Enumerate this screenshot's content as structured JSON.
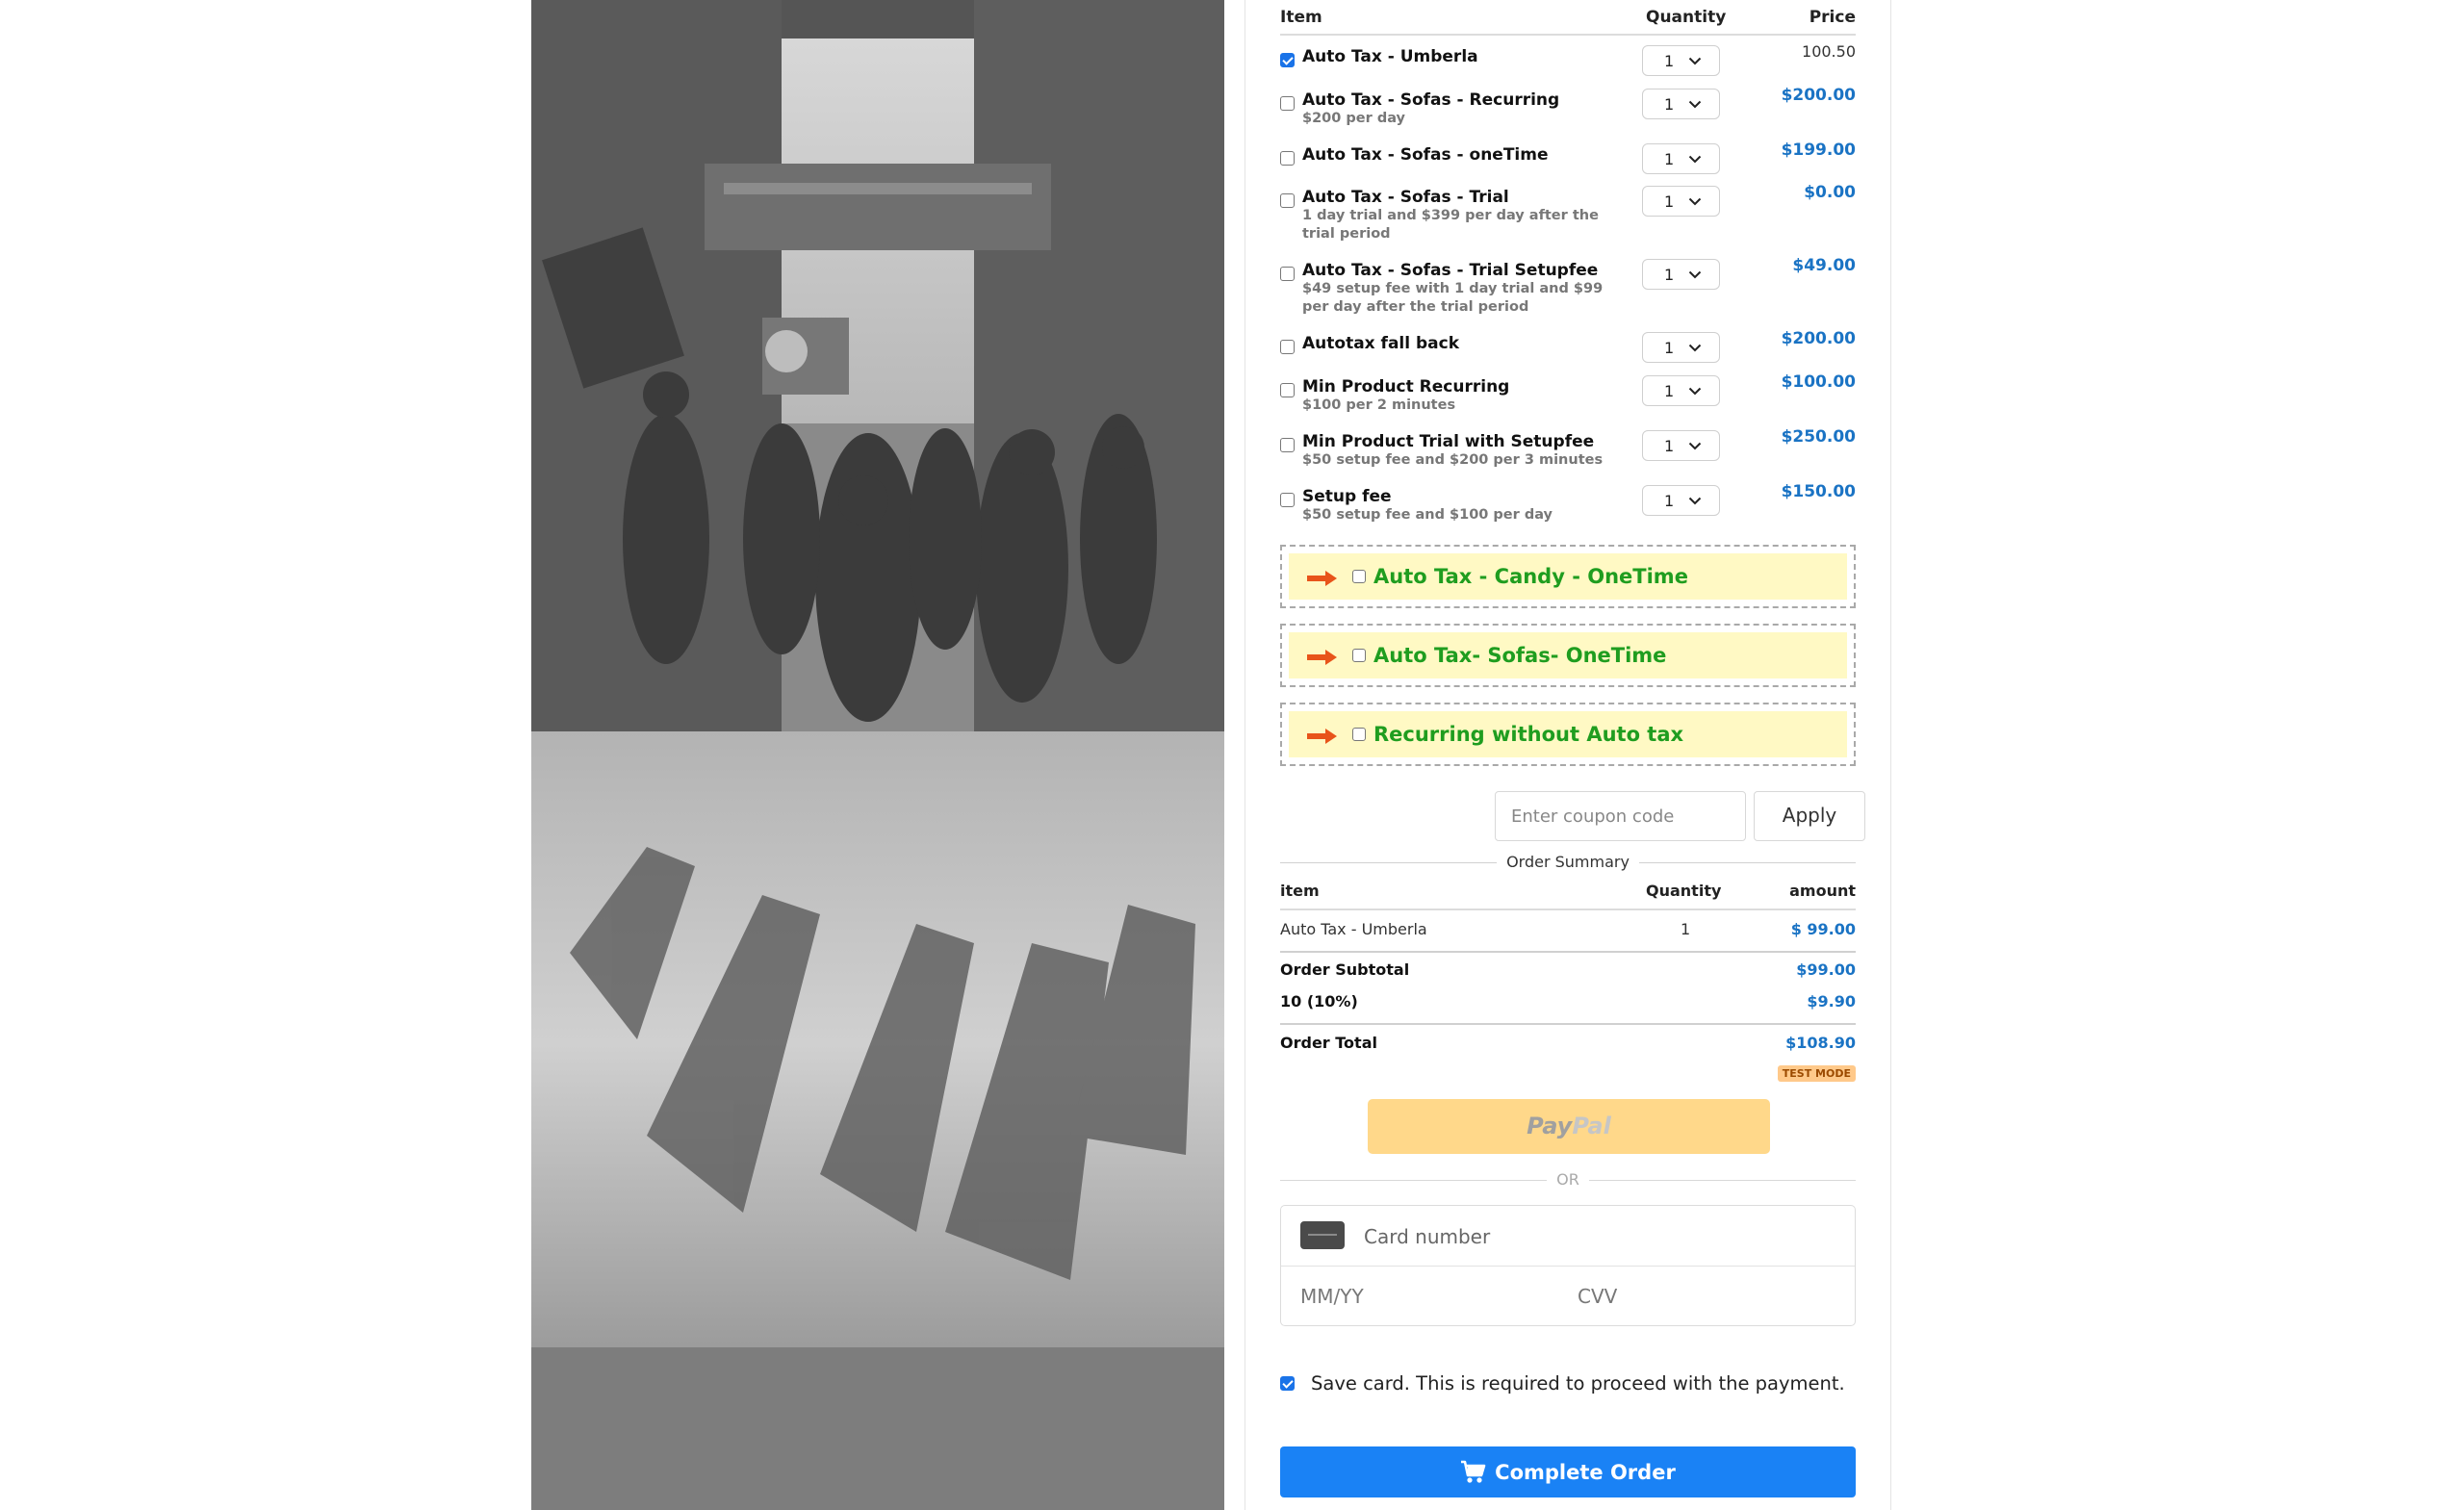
{
  "table_headers": {
    "item": "Item",
    "quantity": "Quantity",
    "price": "Price"
  },
  "products": [
    {
      "name": "Auto Tax - Umberla",
      "desc": "",
      "qty": "1",
      "price": "100.50",
      "checked": true
    },
    {
      "name": "Auto Tax - Sofas - Recurring",
      "desc": "$200 per day",
      "qty": "1",
      "price": "$200.00",
      "checked": false
    },
    {
      "name": "Auto Tax - Sofas - oneTime",
      "desc": "",
      "qty": "1",
      "price": "$199.00",
      "checked": false
    },
    {
      "name": "Auto Tax - Sofas - Trial",
      "desc": "1 day trial and $399 per day after the trial period",
      "qty": "1",
      "price": "$0.00",
      "checked": false
    },
    {
      "name": "Auto Tax - Sofas - Trial Setupfee",
      "desc": "$49 setup fee with 1 day trial and $99 per day after the trial period",
      "qty": "1",
      "price": "$49.00",
      "checked": false
    },
    {
      "name": "Autotax fall back",
      "desc": "",
      "qty": "1",
      "price": "$200.00",
      "checked": false
    },
    {
      "name": "Min Product Recurring",
      "desc": "$100 per 2 minutes",
      "qty": "1",
      "price": "$100.00",
      "checked": false
    },
    {
      "name": "Min Product Trial with Setupfee",
      "desc": "$50 setup fee and $200 per 3 minutes",
      "qty": "1",
      "price": "$250.00",
      "checked": false
    },
    {
      "name": "Setup fee",
      "desc": "$50 setup fee and $100 per day",
      "qty": "1",
      "price": "$150.00",
      "checked": false
    }
  ],
  "order_bumps": [
    "Auto Tax - Candy - OneTime",
    "Auto Tax- Sofas- OneTime",
    "Recurring without Auto tax"
  ],
  "coupon": {
    "placeholder": "Enter coupon code",
    "apply_label": "Apply"
  },
  "summary": {
    "title": "Order Summary",
    "headers": {
      "item": "item",
      "quantity": "Quantity",
      "amount": "amount"
    },
    "line": {
      "item": "Auto Tax - Umberla",
      "quantity": "1",
      "amount": "$ 99.00"
    },
    "subtotal_label": "Order Subtotal",
    "subtotal": "$99.00",
    "tax_label": "10 (10%)",
    "tax": "$9.90",
    "total_label": "Order Total",
    "total": "$108.90",
    "test_mode": "TEST MODE"
  },
  "paypal": {
    "pay": "Pay",
    "pal": "Pal"
  },
  "or_label": "OR",
  "card": {
    "number_placeholder": "Card number",
    "expiry_placeholder": "MM/YY",
    "cvv_placeholder": "CVV"
  },
  "save_card": {
    "label": "Save card. This is required to proceed with the payment.",
    "checked": true
  },
  "complete_label": "Complete Order",
  "colors": {
    "accent": "#1a82f5",
    "price_blue": "#1a73c4",
    "bump_green": "#1f9d1f",
    "bump_bg": "#fff9c4",
    "paypal_bg": "#ffd88a"
  }
}
